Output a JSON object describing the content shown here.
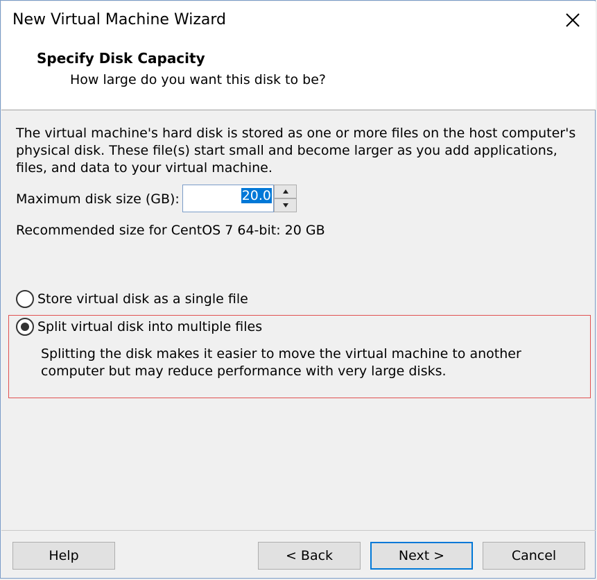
{
  "window": {
    "title": "New Virtual Machine Wizard"
  },
  "header": {
    "title": "Specify Disk Capacity",
    "subtitle": "How large do you want this disk to be?"
  },
  "main": {
    "description": "The virtual machine's hard disk is stored as one or more files on the host computer's physical disk. These file(s) start small and become larger as you add applications, files, and data to your virtual machine.",
    "disk_size_label": "Maximum disk size (GB):",
    "disk_size_value": "20.0",
    "recommended": "Recommended size for CentOS 7 64-bit: 20 GB",
    "options": {
      "single_label": "Store virtual disk as a single file",
      "single_checked": false,
      "split_label": "Split virtual disk into multiple files",
      "split_checked": true,
      "split_description": "Splitting the disk makes it easier to move the virtual machine to another computer but may reduce performance with very large disks."
    }
  },
  "buttons": {
    "help": "Help",
    "back": "< Back",
    "next": "Next >",
    "cancel": "Cancel"
  },
  "icons": {
    "close": "close-icon",
    "spin_up": "arrow-up-icon",
    "spin_down": "arrow-down-icon"
  },
  "colors": {
    "accent": "#0078d7",
    "focus_border": "#e05050",
    "window_border": "#7a9cc8"
  }
}
